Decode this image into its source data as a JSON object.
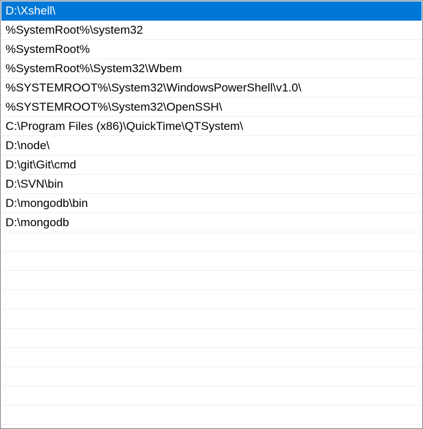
{
  "path_list": {
    "selected_index": 0,
    "selected_color": "#0078d7",
    "items": [
      "D:\\Xshell\\",
      "%SystemRoot%\\system32",
      "%SystemRoot%",
      "%SystemRoot%\\System32\\Wbem",
      "%SYSTEMROOT%\\System32\\WindowsPowerShell\\v1.0\\",
      "%SYSTEMROOT%\\System32\\OpenSSH\\",
      "C:\\Program Files (x86)\\QuickTime\\QTSystem\\",
      "D:\\node\\",
      "D:\\git\\Git\\cmd",
      "D:\\SVN\\bin",
      "D:\\mongodb\\bin",
      "D:\\mongodb"
    ]
  }
}
